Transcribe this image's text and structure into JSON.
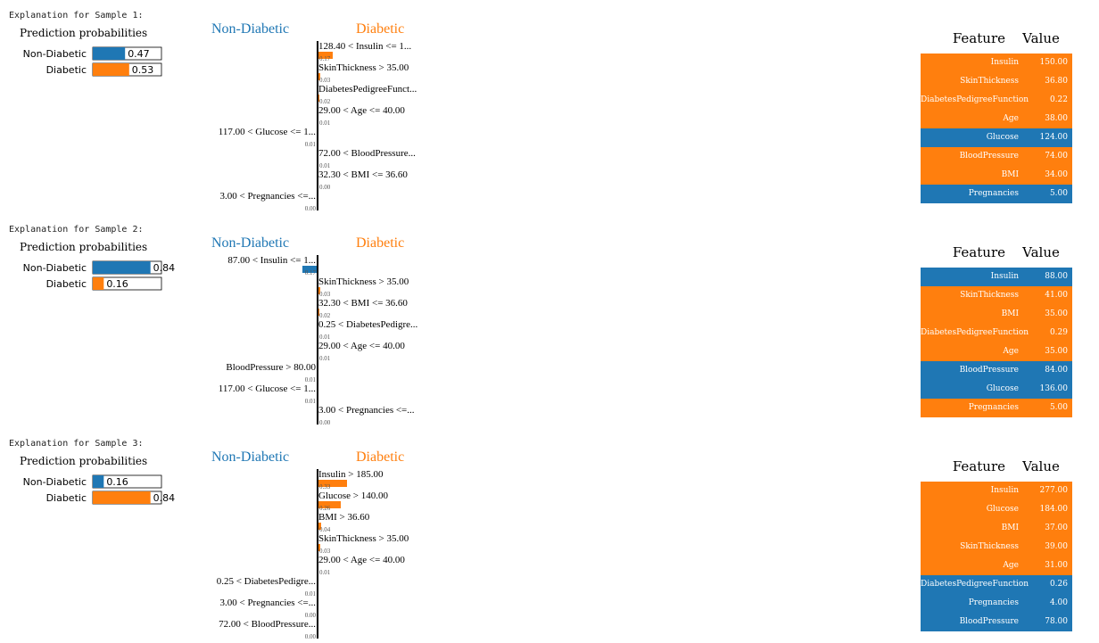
{
  "colors": {
    "non_diabetic": "#1f77b4",
    "diabetic": "#ff7f0e"
  },
  "samples": [
    {
      "heading": "Explanation for Sample 1:",
      "probs_title": "Prediction probabilities",
      "probabilities": [
        {
          "label": "Non-Diabetic",
          "value": 0.47,
          "text": "0.47"
        },
        {
          "label": "Diabetic",
          "value": 0.53,
          "text": "0.53"
        }
      ],
      "left_class": "Non-Diabetic",
      "right_class": "Diabetic",
      "weights": [
        {
          "label": "128.40 < Insulin <= 1...",
          "weight": 0.17,
          "text": "0.17",
          "side": "right"
        },
        {
          "label": "SkinThickness > 35.00",
          "weight": 0.03,
          "text": "0.03",
          "side": "right"
        },
        {
          "label": "DiabetesPedigreeFunct...",
          "weight": 0.02,
          "text": "0.02",
          "side": "right"
        },
        {
          "label": "29.00 < Age <= 40.00",
          "weight": 0.01,
          "text": "0.01",
          "side": "right"
        },
        {
          "label": "117.00 < Glucose <= 1...",
          "weight": 0.01,
          "text": "0.01",
          "side": "left"
        },
        {
          "label": "72.00 < BloodPressure...",
          "weight": 0.01,
          "text": "0.01",
          "side": "right"
        },
        {
          "label": "32.30 < BMI <= 36.60",
          "weight": 0.0,
          "text": "0.00",
          "side": "right"
        },
        {
          "label": "3.00 < Pregnancies <=...",
          "weight": 0.0,
          "text": "0.00",
          "side": "left"
        }
      ],
      "table_header": {
        "feature": "Feature",
        "value": "Value"
      },
      "table": [
        {
          "feature": "Insulin",
          "value": "150.00",
          "side": "right"
        },
        {
          "feature": "SkinThickness",
          "value": "36.80",
          "side": "right"
        },
        {
          "feature": "DiabetesPedigreeFunction",
          "value": "0.22",
          "side": "right"
        },
        {
          "feature": "Age",
          "value": "38.00",
          "side": "right"
        },
        {
          "feature": "Glucose",
          "value": "124.00",
          "side": "left"
        },
        {
          "feature": "BloodPressure",
          "value": "74.00",
          "side": "right"
        },
        {
          "feature": "BMI",
          "value": "34.00",
          "side": "right"
        },
        {
          "feature": "Pregnancies",
          "value": "5.00",
          "side": "left"
        }
      ]
    },
    {
      "heading": "Explanation for Sample 2:",
      "probs_title": "Prediction probabilities",
      "probabilities": [
        {
          "label": "Non-Diabetic",
          "value": 0.84,
          "text": "0.84"
        },
        {
          "label": "Diabetic",
          "value": 0.16,
          "text": "0.16"
        }
      ],
      "left_class": "Non-Diabetic",
      "right_class": "Diabetic",
      "weights": [
        {
          "label": "87.00 < Insulin <= 1...",
          "weight": 0.17,
          "text": "0.17",
          "side": "left"
        },
        {
          "label": "SkinThickness > 35.00",
          "weight": 0.03,
          "text": "0.03",
          "side": "right"
        },
        {
          "label": "32.30 < BMI <= 36.60",
          "weight": 0.02,
          "text": "0.02",
          "side": "right"
        },
        {
          "label": "0.25 < DiabetesPedigre...",
          "weight": 0.01,
          "text": "0.01",
          "side": "right"
        },
        {
          "label": "29.00 < Age <= 40.00",
          "weight": 0.01,
          "text": "0.01",
          "side": "right"
        },
        {
          "label": "BloodPressure > 80.00",
          "weight": 0.01,
          "text": "0.01",
          "side": "left"
        },
        {
          "label": "117.00 < Glucose <= 1...",
          "weight": 0.01,
          "text": "0.01",
          "side": "left"
        },
        {
          "label": "3.00 < Pregnancies <=...",
          "weight": 0.0,
          "text": "0.00",
          "side": "right"
        }
      ],
      "table_header": {
        "feature": "Feature",
        "value": "Value"
      },
      "table": [
        {
          "feature": "Insulin",
          "value": "88.00",
          "side": "left"
        },
        {
          "feature": "SkinThickness",
          "value": "41.00",
          "side": "right"
        },
        {
          "feature": "BMI",
          "value": "35.00",
          "side": "right"
        },
        {
          "feature": "DiabetesPedigreeFunction",
          "value": "0.29",
          "side": "right"
        },
        {
          "feature": "Age",
          "value": "35.00",
          "side": "right"
        },
        {
          "feature": "BloodPressure",
          "value": "84.00",
          "side": "left"
        },
        {
          "feature": "Glucose",
          "value": "136.00",
          "side": "left"
        },
        {
          "feature": "Pregnancies",
          "value": "5.00",
          "side": "right"
        }
      ]
    },
    {
      "heading": "Explanation for Sample 3:",
      "probs_title": "Prediction probabilities",
      "probabilities": [
        {
          "label": "Non-Diabetic",
          "value": 0.16,
          "text": "0.16"
        },
        {
          "label": "Diabetic",
          "value": 0.84,
          "text": "0.84"
        }
      ],
      "left_class": "Non-Diabetic",
      "right_class": "Diabetic",
      "weights": [
        {
          "label": "Insulin > 185.00",
          "weight": 0.33,
          "text": "0.33",
          "side": "right"
        },
        {
          "label": "Glucose > 140.00",
          "weight": 0.26,
          "text": "0.26",
          "side": "right"
        },
        {
          "label": "BMI > 36.60",
          "weight": 0.04,
          "text": "0.04",
          "side": "right"
        },
        {
          "label": "SkinThickness > 35.00",
          "weight": 0.03,
          "text": "0.03",
          "side": "right"
        },
        {
          "label": "29.00 < Age <= 40.00",
          "weight": 0.01,
          "text": "0.01",
          "side": "right"
        },
        {
          "label": "0.25 < DiabetesPedigre...",
          "weight": 0.01,
          "text": "0.01",
          "side": "left"
        },
        {
          "label": "3.00 < Pregnancies <=...",
          "weight": 0.0,
          "text": "0.00",
          "side": "left"
        },
        {
          "label": "72.00 < BloodPressure...",
          "weight": 0.0,
          "text": "0.00",
          "side": "left"
        }
      ],
      "table_header": {
        "feature": "Feature",
        "value": "Value"
      },
      "table": [
        {
          "feature": "Insulin",
          "value": "277.00",
          "side": "right"
        },
        {
          "feature": "Glucose",
          "value": "184.00",
          "side": "right"
        },
        {
          "feature": "BMI",
          "value": "37.00",
          "side": "right"
        },
        {
          "feature": "SkinThickness",
          "value": "39.00",
          "side": "right"
        },
        {
          "feature": "Age",
          "value": "31.00",
          "side": "right"
        },
        {
          "feature": "DiabetesPedigreeFunction",
          "value": "0.26",
          "side": "left"
        },
        {
          "feature": "Pregnancies",
          "value": "4.00",
          "side": "left"
        },
        {
          "feature": "BloodPressure",
          "value": "78.00",
          "side": "left"
        }
      ]
    }
  ],
  "chart_data": [
    {
      "type": "bar",
      "title": "Prediction probabilities",
      "categories": [
        "Non-Diabetic",
        "Diabetic"
      ],
      "values": [
        0.47,
        0.53
      ]
    },
    {
      "type": "bar",
      "categories": [
        "128.40 < Insulin <= 1...",
        "SkinThickness > 35.00",
        "DiabetesPedigreeFunct...",
        "29.00 < Age <= 40.00",
        "117.00 < Glucose <= 1...",
        "72.00 < BloodPressure...",
        "32.30 < BMI <= 36.60",
        "3.00 < Pregnancies <=..."
      ],
      "values": [
        0.17,
        0.03,
        0.02,
        0.01,
        -0.01,
        0.01,
        0.0,
        -0.0
      ]
    },
    {
      "type": "bar",
      "title": "Prediction probabilities",
      "categories": [
        "Non-Diabetic",
        "Diabetic"
      ],
      "values": [
        0.84,
        0.16
      ]
    },
    {
      "type": "bar",
      "categories": [
        "87.00 < Insulin <= 1...",
        "SkinThickness > 35.00",
        "32.30 < BMI <= 36.60",
        "0.25 < DiabetesPedigre...",
        "29.00 < Age <= 40.00",
        "BloodPressure > 80.00",
        "117.00 < Glucose <= 1...",
        "3.00 < Pregnancies <=..."
      ],
      "values": [
        -0.17,
        0.03,
        0.02,
        0.01,
        0.01,
        -0.01,
        -0.01,
        0.0
      ]
    },
    {
      "type": "bar",
      "title": "Prediction probabilities",
      "categories": [
        "Non-Diabetic",
        "Diabetic"
      ],
      "values": [
        0.16,
        0.84
      ]
    },
    {
      "type": "bar",
      "categories": [
        "Insulin > 185.00",
        "Glucose > 140.00",
        "BMI > 36.60",
        "SkinThickness > 35.00",
        "29.00 < Age <= 40.00",
        "0.25 < DiabetesPedigre...",
        "3.00 < Pregnancies <=...",
        "72.00 < BloodPressure..."
      ],
      "values": [
        0.33,
        0.26,
        0.04,
        0.03,
        0.01,
        -0.01,
        -0.0,
        -0.0
      ]
    }
  ]
}
